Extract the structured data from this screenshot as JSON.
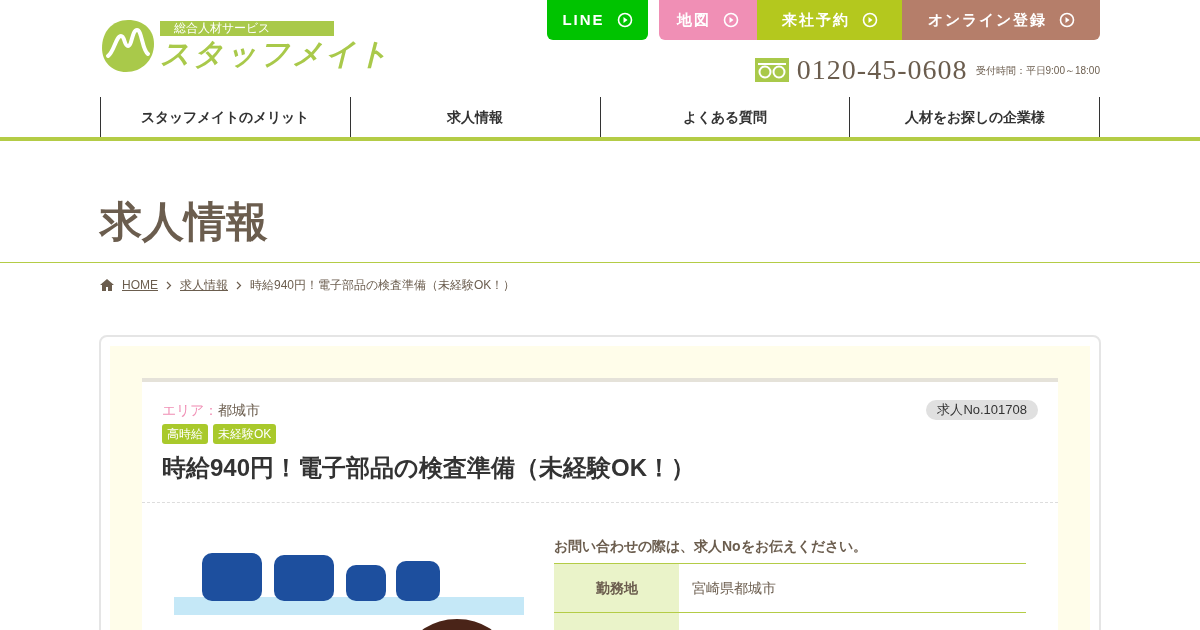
{
  "logo": {
    "tagline": "総合人材サービス",
    "name": "スタッフメイト"
  },
  "header_buttons": [
    {
      "label": "LINE",
      "kind": "line"
    },
    {
      "label": "地図",
      "kind": "map"
    },
    {
      "label": "来社予約",
      "kind": "visit"
    },
    {
      "label": "オンライン登録",
      "kind": "register"
    }
  ],
  "phone": {
    "number": "0120-45-0608",
    "hours": "受付時間：平日9:00～18:00"
  },
  "nav": [
    "スタッフメイトのメリット",
    "求人情報",
    "よくある質問",
    "人材をお探しの企業様"
  ],
  "page_title": "求人情報",
  "breadcrumb": [
    {
      "label": "HOME",
      "link": true
    },
    {
      "label": "求人情報",
      "link": true
    },
    {
      "label": "時給940円！電子部品の検査準備（未経験OK！）",
      "link": false
    }
  ],
  "job": {
    "area_label": "エリア：",
    "area": "都城市",
    "job_no": "求人No.101708",
    "tags": [
      "高時給",
      "未経験OK"
    ],
    "title": "時給940円！電子部品の検査準備（未経験OK！）",
    "image": {
      "kind": "picture"
    },
    "note": "お問い合わせの際は、求人Noをお伝えください。",
    "details": [
      {
        "label": "勤務地",
        "value": "宮崎県都城市"
      }
    ]
  }
}
